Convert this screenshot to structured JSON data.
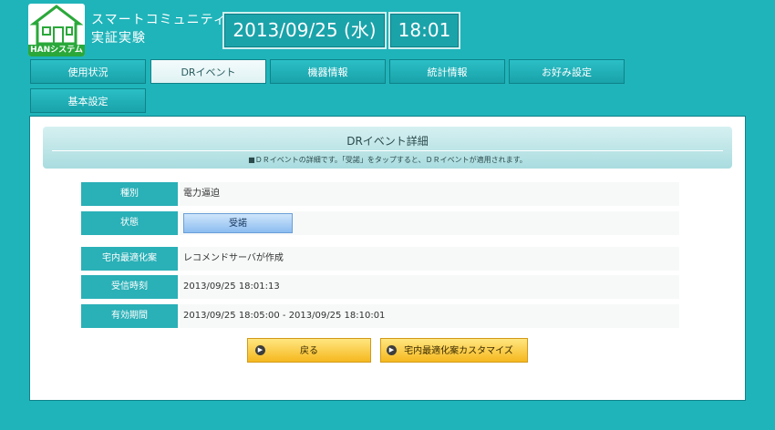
{
  "header": {
    "logo_text": "HANシステム",
    "app_title_line1": "スマートコミュニティ",
    "app_title_line2": "実証実験",
    "date": "2013/09/25 (水)",
    "time": "18:01"
  },
  "tabs": [
    {
      "label": "使用状況",
      "active": false
    },
    {
      "label": "DRイベント",
      "active": true
    },
    {
      "label": "機器情報",
      "active": false
    },
    {
      "label": "統計情報",
      "active": false
    },
    {
      "label": "お好み設定",
      "active": false
    },
    {
      "label": "基本設定",
      "active": false
    }
  ],
  "panel": {
    "title": "DRイベント詳細",
    "description": "■ＤＲイベントの詳細です。「受諾」をタップすると、ＤＲイベントが適用されます。"
  },
  "details": [
    {
      "label": "種別",
      "value": "電力逼迫"
    },
    {
      "label": "状態",
      "value": "受諾"
    },
    {
      "label": "宅内最適化案",
      "value": "レコメンドサーバが作成"
    },
    {
      "label": "受信時刻",
      "value": "2013/09/25 18:01:13"
    },
    {
      "label": "有効期間",
      "value": "2013/09/25 18:05:00 - 2013/09/25 18:10:01"
    }
  ],
  "buttons": {
    "back_label": "戻る",
    "customize_label": "宅内最適化案カスタマイズ"
  },
  "icons": {
    "logo": "house-icon",
    "button_arrow": "arrow-right-circle-icon"
  },
  "colors": {
    "background": "#1fb4ba",
    "tab": "#19a2a9",
    "row_label": "#2ab0b7",
    "button": "#f6b81f",
    "status_button": "#8cbcf0"
  }
}
